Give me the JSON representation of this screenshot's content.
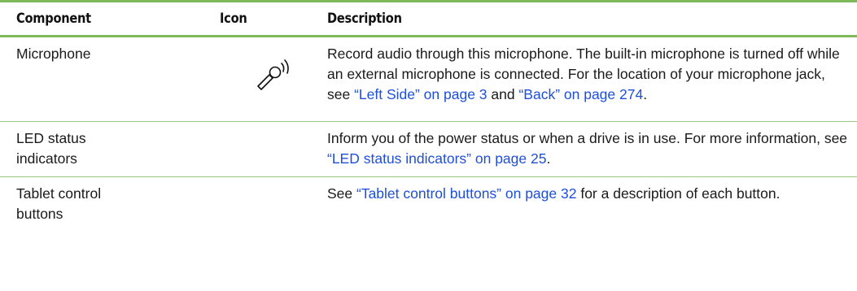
{
  "table": {
    "headers": {
      "component": "Component",
      "icon": "Icon",
      "description": "Description"
    },
    "rows": [
      {
        "component": "Microphone",
        "icon": "microphone-icon",
        "desc_parts": [
          "Record audio through this microphone. The built-in microphone is turned off while an external microphone is connected. For the location of your microphone jack, see ",
          "“Left Side” on page 3",
          " and ",
          "“Back” on page 274",
          "."
        ]
      },
      {
        "component": "LED status indicators",
        "desc_parts": [
          "Inform you of the power status or when a drive is in use. For more information, see ",
          "“LED status indicators” on page 25",
          "."
        ]
      },
      {
        "component": "Tablet control buttons",
        "desc_parts": [
          "See ",
          "“Tablet control buttons” on page 32",
          " for a description of each button."
        ]
      }
    ]
  },
  "colors": {
    "rule": "#7fb858",
    "link": "#1f4fd8",
    "text": "#1a1a1a"
  }
}
